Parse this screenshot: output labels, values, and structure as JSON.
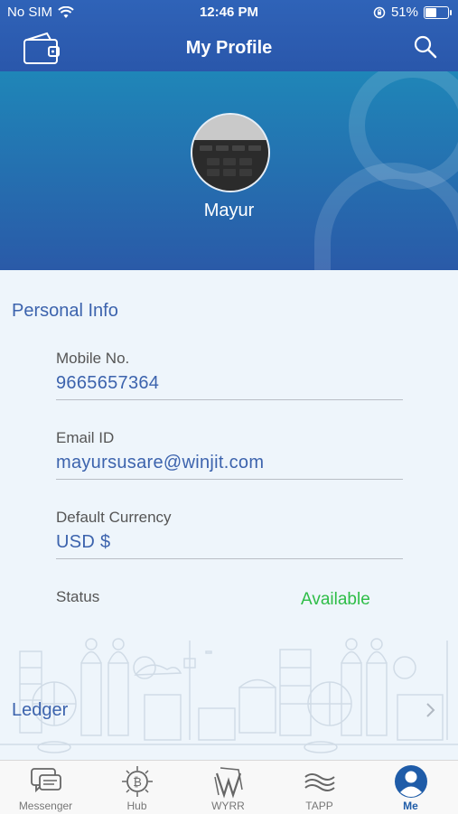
{
  "status_bar": {
    "carrier": "No SIM",
    "time": "12:46 PM",
    "battery_percent": "51%",
    "battery_level": 0.51,
    "icons": [
      "wifi-icon",
      "orientation-lock-icon",
      "battery-icon"
    ]
  },
  "navbar": {
    "title": "My Profile",
    "left_icon": "wallet-icon",
    "right_icon": "search-icon"
  },
  "profile": {
    "name": "Mayur",
    "avatar_icon": "avatar-photo"
  },
  "personal_info": {
    "title": "Personal Info",
    "mobile_label": "Mobile No.",
    "mobile_value": "9665657364",
    "email_label": "Email ID",
    "email_value": "mayursusare@winjit.com",
    "currency_label": "Default Currency",
    "currency_value": "USD $",
    "status_label": "Status",
    "status_value": "Available"
  },
  "ledger": {
    "label": "Ledger",
    "icon": "chevron-right-icon"
  },
  "tabs": [
    {
      "label": "Messenger",
      "icon": "messenger-icon",
      "active": false
    },
    {
      "label": "Hub",
      "icon": "hub-icon",
      "active": false
    },
    {
      "label": "WYRR",
      "icon": "wyrr-icon",
      "active": false
    },
    {
      "label": "TAPP",
      "icon": "tapp-icon",
      "active": false
    },
    {
      "label": "Me",
      "icon": "me-icon",
      "active": true
    }
  ],
  "colors": {
    "header": "#2f63b8",
    "accent_text": "#3c63ad",
    "status_available": "#2ebd47",
    "active_tab": "#1f5ca8"
  }
}
